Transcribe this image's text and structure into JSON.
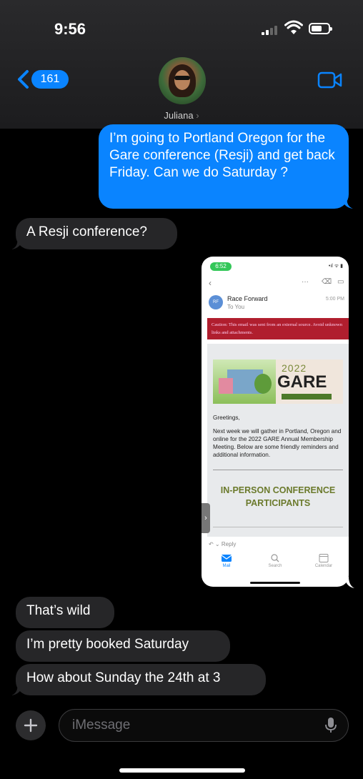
{
  "status_bar": {
    "time": "9:56"
  },
  "header": {
    "back_badge": "161",
    "contact_name": "Juliana",
    "name_chevron": "›"
  },
  "messages": {
    "m1": "I’m going to Portland Oregon for the Gare conference (Resji) and get back Friday. Can we do Saturday ?",
    "m2": "A Resji conference?",
    "m4": "That’s wild",
    "m5": "I’m pretty booked Saturday",
    "m6": "How about Sunday the 24th at 3"
  },
  "screenshot": {
    "time": "6:52",
    "sender_initials": "RF",
    "sender": "Race Forward",
    "to": "To You",
    "date": "5:00 PM",
    "caution": "Caution: This email was sent from an external source. Avoid unknown links and attachments.",
    "banner_year": "2022",
    "banner_title": "GARE",
    "greeting": "Greetings,",
    "body": "Next week we will gather in Portland, Oregon and online for the 2022 GARE Annual Membership Meeting. Below are some friendly reminders and additional information.",
    "heading": "IN-PERSON CONFERENCE PARTICIPANTS",
    "reply": "Reply",
    "tabs": [
      "Mail",
      "Search",
      "Calendar"
    ]
  },
  "composer": {
    "placeholder": "iMessage"
  }
}
